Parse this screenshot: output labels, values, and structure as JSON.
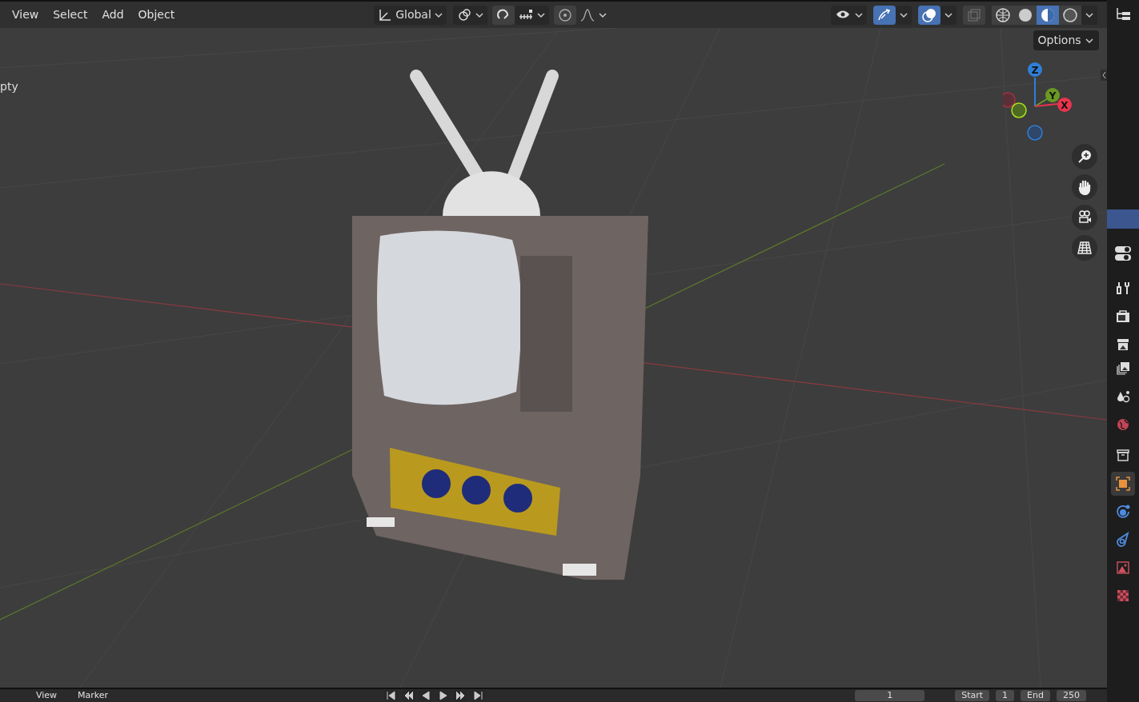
{
  "header": {
    "menus": [
      "View",
      "Select",
      "Add",
      "Object"
    ],
    "transform_orientation": {
      "label": "Global"
    },
    "snap": {
      "on": false
    },
    "proportional_edit": {
      "on": false
    },
    "overlays": {
      "on": true
    },
    "xray": {
      "on": false
    },
    "shading_modes": [
      {
        "kind": "wireframe",
        "selected": false
      },
      {
        "kind": "solid",
        "selected": false
      },
      {
        "kind": "material",
        "selected": true
      },
      {
        "kind": "rendered",
        "selected": false
      }
    ]
  },
  "viewport": {
    "object_info": "pty",
    "options": "Options",
    "axes": [
      {
        "label": "Z",
        "color": "#2f7fd8"
      },
      {
        "label": "Y",
        "color": "#6a9a23"
      },
      {
        "label": "X",
        "color": "#e8344d"
      }
    ],
    "nav_buttons": [
      {
        "kind": "zoom"
      },
      {
        "kind": "pan"
      },
      {
        "kind": "camera"
      },
      {
        "kind": "ortho"
      }
    ]
  },
  "properties_tabs": [
    {
      "kind": "tool",
      "selected": false
    },
    {
      "kind": "render",
      "selected": false
    },
    {
      "kind": "output",
      "selected": false
    },
    {
      "kind": "view_layer",
      "selected": false
    },
    {
      "kind": "scene",
      "selected": false
    },
    {
      "kind": "world",
      "selected": false
    },
    {
      "kind": "collection",
      "selected": false
    },
    {
      "kind": "object",
      "selected": true
    },
    {
      "kind": "modifiers",
      "selected": false
    },
    {
      "kind": "physics",
      "selected": false
    },
    {
      "kind": "data",
      "selected": false
    },
    {
      "kind": "texture",
      "selected": false
    }
  ],
  "timeline": {
    "menus": [
      "View",
      "Marker"
    ],
    "current_frame": "1",
    "start_label": "Start",
    "start": "1",
    "end_label": "End",
    "end": "250"
  }
}
